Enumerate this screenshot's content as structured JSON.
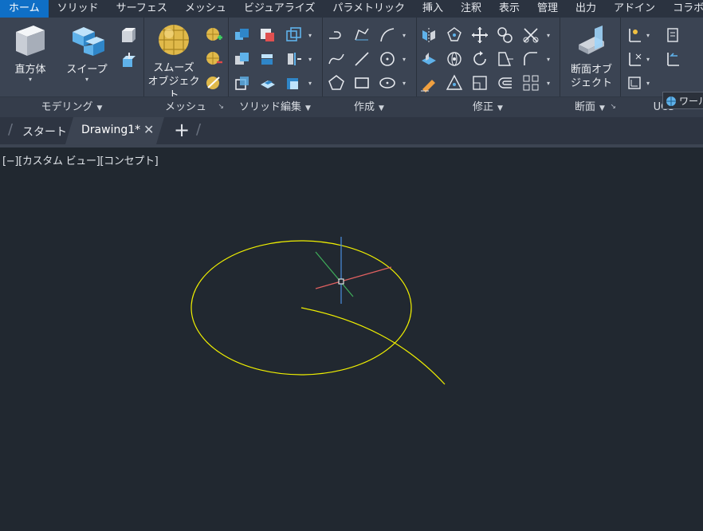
{
  "menu_tabs": [
    "ホーム",
    "ソリッド",
    "サーフェス",
    "メッシュ",
    "ビジュアライズ",
    "パラメトリック",
    "挿入",
    "注釈",
    "表示",
    "管理",
    "出力",
    "アドイン",
    "コラボレーション"
  ],
  "ribbon": {
    "modeling": {
      "title": "モデリング",
      "box_label": "直方体",
      "sweep_label": "スイープ"
    },
    "mesh": {
      "title": "メッシュ",
      "smooth_label_1": "スムーズ",
      "smooth_label_2": "オブジェクト"
    },
    "solid_edit": {
      "title": "ソリッド編集"
    },
    "create": {
      "title": "作成"
    },
    "modify": {
      "title": "修正"
    },
    "section": {
      "title": "断面",
      "label_1": "断面オブ",
      "label_2": "ジェクト"
    },
    "ucs": {
      "title": "UCS",
      "world_label": "ワールド"
    }
  },
  "file_tabs": {
    "start": "スタート",
    "active": "Drawing1*",
    "close": "✕",
    "new": "+"
  },
  "viewport": {
    "label": "[−][カスタム ビュー][コンセプト]"
  },
  "colors": {
    "accent": "#0f6fc6",
    "ribbon_bg": "#3b4453",
    "viewport_bg": "#212830",
    "geometry": "#f0f000"
  },
  "icons": [
    "box-icon",
    "sweep-icon",
    "smooth-object-icon",
    "section-plane-icon",
    "world-ucs-icon",
    "ucs-gizmo-icon"
  ]
}
